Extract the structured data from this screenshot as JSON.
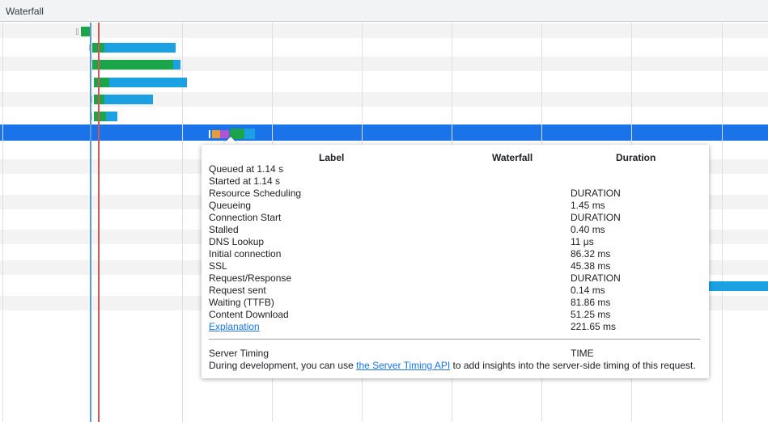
{
  "header": {
    "title": "Waterfall"
  },
  "popup": {
    "columns": {
      "label": "Label",
      "waterfall": "Waterfall",
      "duration": "Duration"
    },
    "queued": "Queued at 1.14 s",
    "started": "Started at 1.14 s",
    "rows": [
      {
        "label": "Resource Scheduling",
        "value": "DURATION"
      },
      {
        "label": "Queueing",
        "value": "1.45 ms"
      },
      {
        "label": "Connection Start",
        "value": "DURATION"
      },
      {
        "label": "Stalled",
        "value": "0.40 ms"
      },
      {
        "label": "DNS Lookup",
        "value": "11 μs"
      },
      {
        "label": "Initial connection",
        "value": "86.32 ms"
      },
      {
        "label": "SSL",
        "value": "45.38 ms"
      },
      {
        "label": "Request/Response",
        "value": "DURATION"
      },
      {
        "label": "Request sent",
        "value": "0.14 ms"
      },
      {
        "label": "Waiting (TTFB)",
        "value": "81.86 ms"
      },
      {
        "label": "Content Download",
        "value": "51.25 ms"
      }
    ],
    "explanation": {
      "label": "Explanation",
      "value": "221.65 ms"
    },
    "server_timing": {
      "label": "Server Timing",
      "value": "TIME",
      "note_before": "During development, you can use ",
      "link": "the Server Timing API",
      "note_after": " to add insights into the server-side timing of this request."
    }
  }
}
